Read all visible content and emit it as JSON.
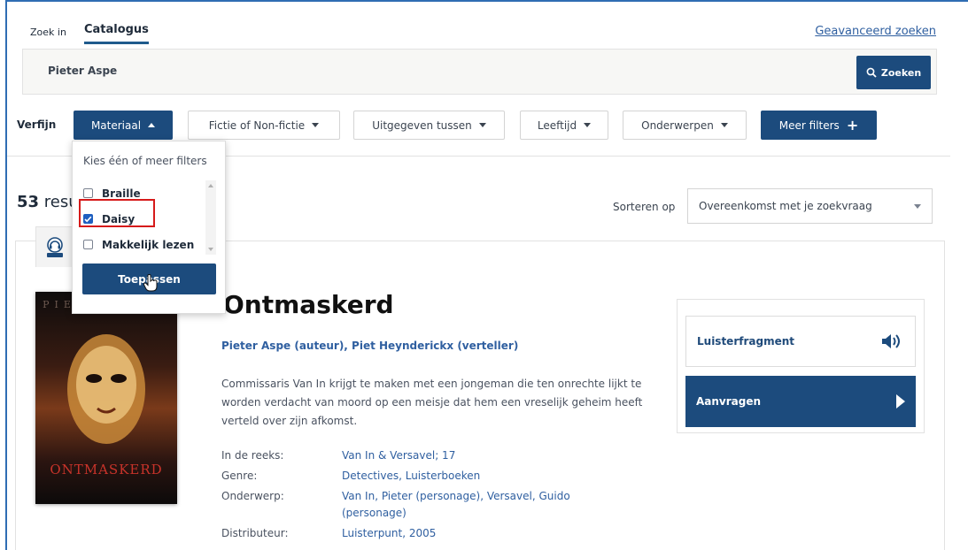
{
  "tabs": {
    "zoek_in": "Zoek in",
    "catalogus": "Catalogus"
  },
  "advanced_search": "Geavanceerd zoeken",
  "search": {
    "value": "Pieter Aspe",
    "button": "Zoeken"
  },
  "filters": {
    "label": "Verfijn",
    "buttons": [
      "Materiaal",
      "Fictie of Non-fictie",
      "Uitgegeven tussen",
      "Leeftijd",
      "Onderwerpen"
    ],
    "more": "Meer filters"
  },
  "material_dropdown": {
    "heading": "Kies één of meer filters",
    "options": [
      {
        "label": "Braille",
        "checked": false
      },
      {
        "label": "Daisy",
        "checked": true
      },
      {
        "label": "Makkelijk lezen",
        "checked": false
      }
    ],
    "apply": "Toepassen"
  },
  "results": {
    "count": "53",
    "suffix_visible": "resu"
  },
  "sort": {
    "label": "Sorteren op",
    "value": "Overeenkomst met je zoekvraag"
  },
  "book": {
    "cover_author": "PIETER ASPE",
    "cover_title": "ONTMASKERD",
    "title": "Ontmaskerd",
    "authors": "Pieter Aspe (auteur), Piet Heynderickx (verteller)",
    "description": "Commissaris Van In krijgt te maken met een jongeman die ten onrechte lijkt te worden verdacht van moord op een meisje dat hem een vreselijk geheim heeft verteld over zijn afkomst.",
    "meta": [
      {
        "label": "In de reeks:",
        "value": "Van In & Versavel; 17"
      },
      {
        "label": "Genre:",
        "value": "Detectives, Luisterboeken"
      },
      {
        "label": "Onderwerp:",
        "value": "Van In, Pieter (personage), Versavel, Guido (personage)"
      },
      {
        "label": "Distributeur:",
        "value": "Luisterpunt, 2005"
      }
    ],
    "listen": "Luisterfragment",
    "request": "Aanvragen"
  },
  "colors": {
    "primary": "#1c4b7d",
    "link": "#2f5fa0",
    "highlight": "#d61a1a"
  }
}
